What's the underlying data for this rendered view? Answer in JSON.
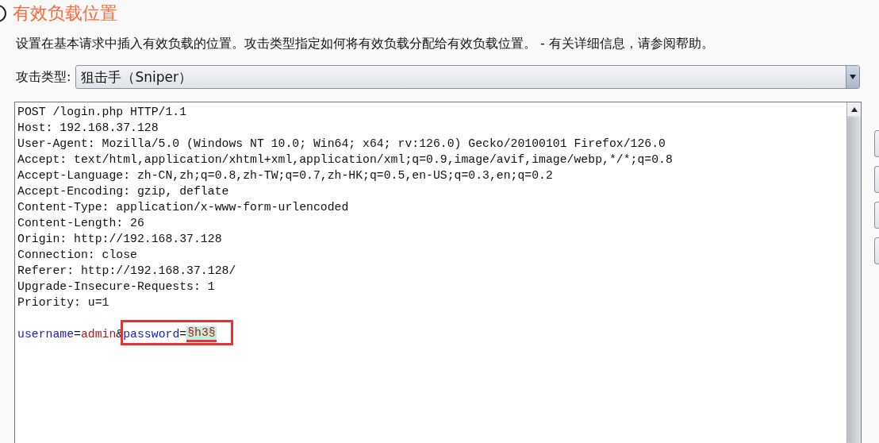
{
  "section": {
    "title": "有效负载位置",
    "description": "设置在基本请求中插入有效负载的位置。攻击类型指定如何将有效负载分配给有效负载位置。 - 有关详细信息，请参阅帮助。"
  },
  "attack_type": {
    "label": "攻击类型:",
    "value": "狙击手（Sniper）"
  },
  "request": {
    "lines": [
      "POST /login.php HTTP/1.1",
      "Host: 192.168.37.128",
      "User-Agent: Mozilla/5.0 (Windows NT 10.0; Win64; x64; rv:126.0) Gecko/20100101 Firefox/126.0",
      "Accept: text/html,application/xhtml+xml,application/xml;q=0.9,image/avif,image/webp,*/*;q=0.8",
      "Accept-Language: zh-CN,zh;q=0.8,zh-TW;q=0.7,zh-HK;q=0.5,en-US;q=0.3,en;q=0.2",
      "Accept-Encoding: gzip, deflate",
      "Content-Type: application/x-www-form-urlencoded",
      "Content-Length: 26",
      "Origin: http://192.168.37.128",
      "Connection: close",
      "Referer: http://192.168.37.128/",
      "Upgrade-Insecure-Requests: 1",
      "Priority: u=1"
    ],
    "body": [
      {
        "kind": "name",
        "text": "username"
      },
      {
        "kind": "plain",
        "text": "="
      },
      {
        "kind": "value",
        "text": "admin"
      },
      {
        "kind": "plain",
        "text": "&"
      },
      {
        "kind": "name",
        "text": "password"
      },
      {
        "kind": "plain",
        "text": "="
      },
      {
        "kind": "payload",
        "text": "§h3§"
      }
    ]
  }
}
